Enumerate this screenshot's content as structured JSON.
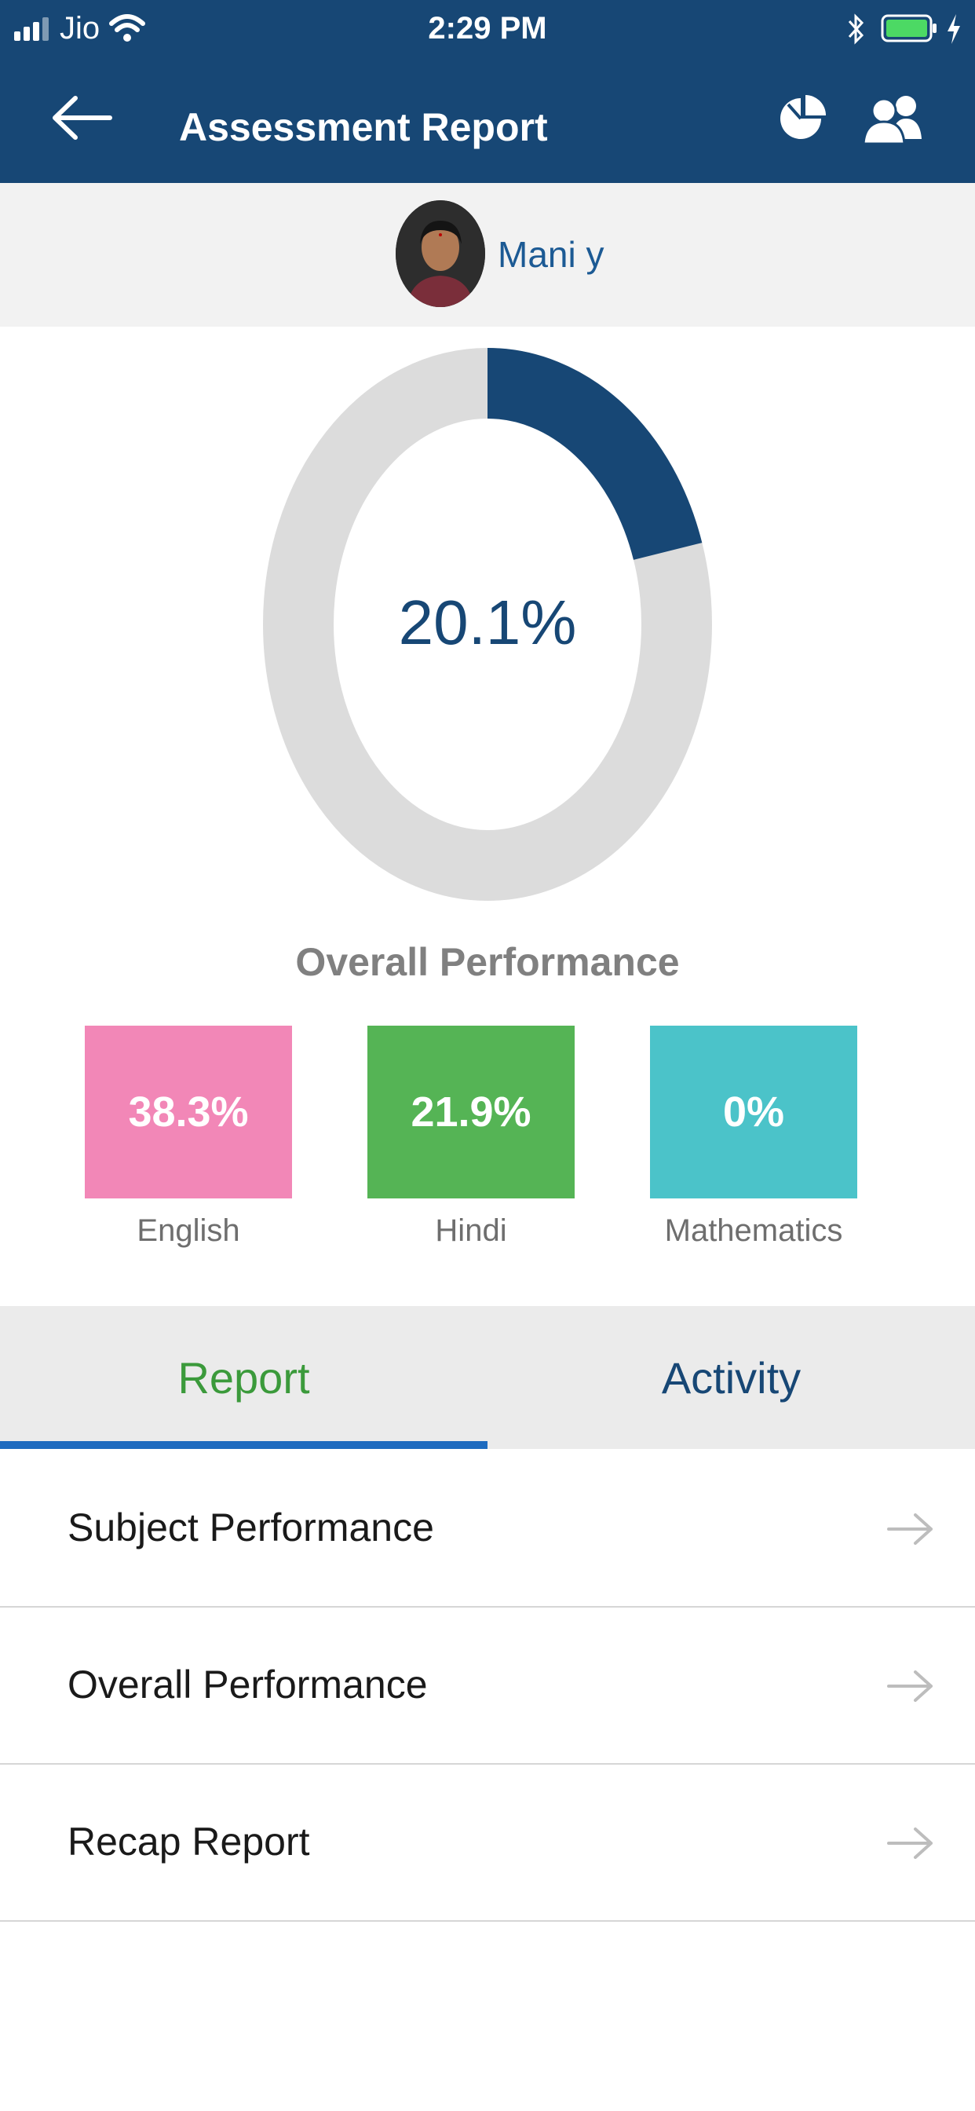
{
  "status_bar": {
    "carrier": "Jio",
    "time": "2:29 PM"
  },
  "header": {
    "title": "Assessment Report",
    "icons": [
      "back-arrow-icon",
      "pie-chart-icon",
      "users-icon"
    ]
  },
  "profile": {
    "name": "Mani y"
  },
  "overall": {
    "percent_text": "20.1%",
    "percent_value": 20.1,
    "label": "Overall Performance",
    "fill_color": "#174775",
    "track_color": "#dcdcdc"
  },
  "subjects": [
    {
      "name": "English",
      "score": "38.3%",
      "color": "#f287b7"
    },
    {
      "name": "Hindi",
      "score": "21.9%",
      "color": "#55b455"
    },
    {
      "name": "Mathematics",
      "score": "0%",
      "color": "#4bc3c9"
    }
  ],
  "tabs": [
    {
      "label": "Report",
      "active": true
    },
    {
      "label": "Activity",
      "active": false
    }
  ],
  "report_items": [
    {
      "label": "Subject Performance"
    },
    {
      "label": "Overall Performance"
    },
    {
      "label": "Recap Report"
    }
  ],
  "colors": {
    "brand": "#174775",
    "active_tab": "#3b9a3b",
    "tab_underline": "#1e6bbf"
  }
}
